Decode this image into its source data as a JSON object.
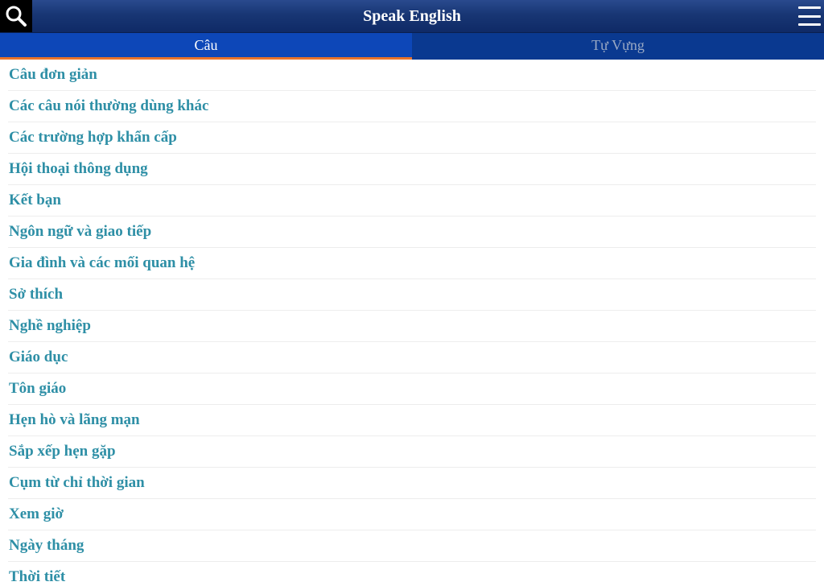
{
  "header": {
    "title": "Speak English",
    "search_icon": "search-icon",
    "menu_icon": "hamburger-menu-icon"
  },
  "tabs": [
    {
      "label": "Câu",
      "active": true
    },
    {
      "label": "Tự Vựng",
      "active": false
    }
  ],
  "colors": {
    "header_bg": "#183674",
    "active_tab_bg": "#0d47b8",
    "inactive_tab_bg": "#0a3990",
    "tab_indicator": "#e8732a",
    "item_text": "#2e8fa6"
  },
  "categories": [
    "Câu đơn giản",
    "Các câu nói thường dùng khác",
    "Các trường hợp khẩn cấp",
    "Hội thoại thông dụng",
    "Kết bạn",
    "Ngôn ngữ và giao tiếp",
    "Gia đình và các mối quan hệ",
    "Sở thích",
    "Nghề nghiệp",
    "Giáo dục",
    "Tôn giáo",
    "Hẹn hò và lãng mạn",
    "Sắp xếp hẹn gặp",
    "Cụm từ chỉ thời gian",
    "Xem giờ",
    "Ngày tháng",
    "Thời tiết"
  ]
}
